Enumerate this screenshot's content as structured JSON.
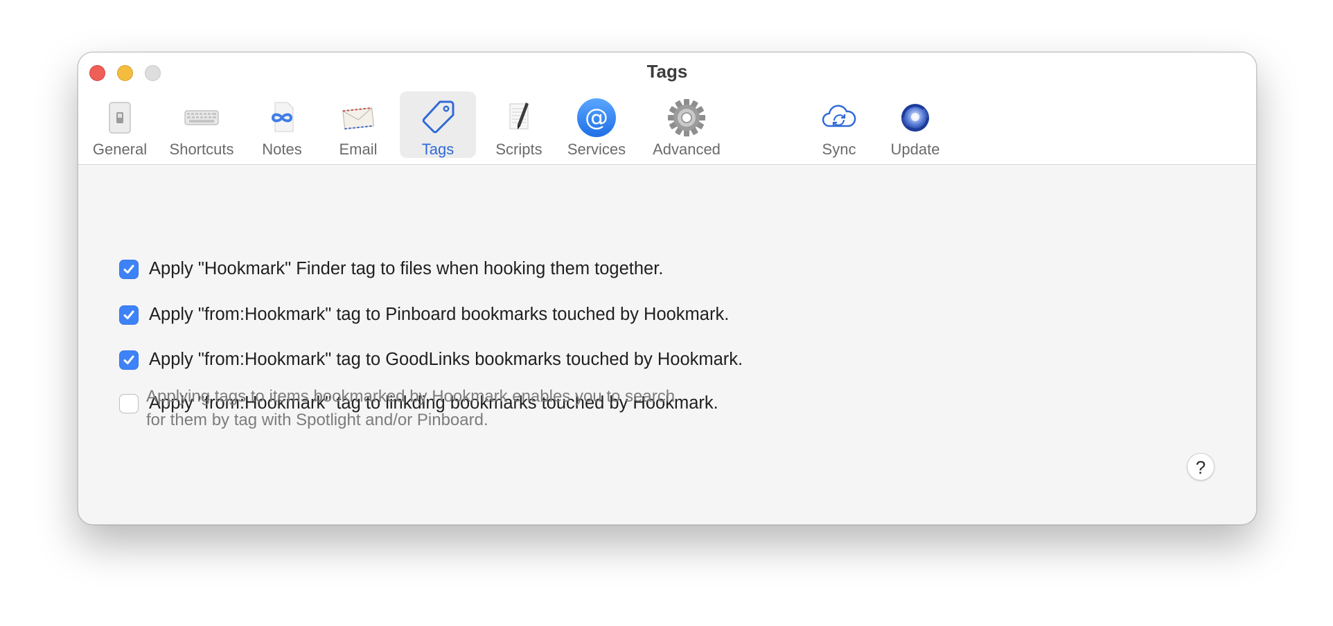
{
  "window": {
    "title": "Tags"
  },
  "tabs": [
    {
      "label": "General",
      "icon": "switch-icon"
    },
    {
      "label": "Shortcuts",
      "icon": "keyboard-icon"
    },
    {
      "label": "Notes",
      "icon": "notes-infinity-icon"
    },
    {
      "label": "Email",
      "icon": "envelope-icon"
    },
    {
      "label": "Tags",
      "icon": "tag-icon",
      "selected": true
    },
    {
      "label": "Scripts",
      "icon": "script-icon"
    },
    {
      "label": "Services",
      "icon": "at-sign-icon"
    },
    {
      "label": "Advanced",
      "icon": "gear-icon"
    },
    {
      "label": "Sync",
      "icon": "cloud-sync-icon"
    },
    {
      "label": "Update",
      "icon": "update-icon"
    }
  ],
  "options": [
    {
      "label": "Apply \"Hookmark\" Finder tag to files when hooking them together.",
      "checked": true
    },
    {
      "label": "Apply \"from:Hookmark\" tag to Pinboard bookmarks touched by Hookmark.",
      "checked": true
    },
    {
      "label": "Apply \"from:Hookmark\" tag to GoodLinks bookmarks touched by Hookmark.",
      "checked": true
    },
    {
      "label": "Apply \"from:Hookmark\" tag to linkding bookmarks touched by Hookmark.",
      "checked": false
    }
  ],
  "description": {
    "line1": "Applying tags to items bookmarked by Hookmark enables you to search",
    "line2": "for them by tag with Spotlight and/or Pinboard."
  },
  "help_button": {
    "label": "?"
  },
  "colors": {
    "accent": "#3e82f7",
    "selected_tab_text": "#2f6ad8",
    "close": "#ed5f57",
    "minimize": "#f5bd40"
  }
}
